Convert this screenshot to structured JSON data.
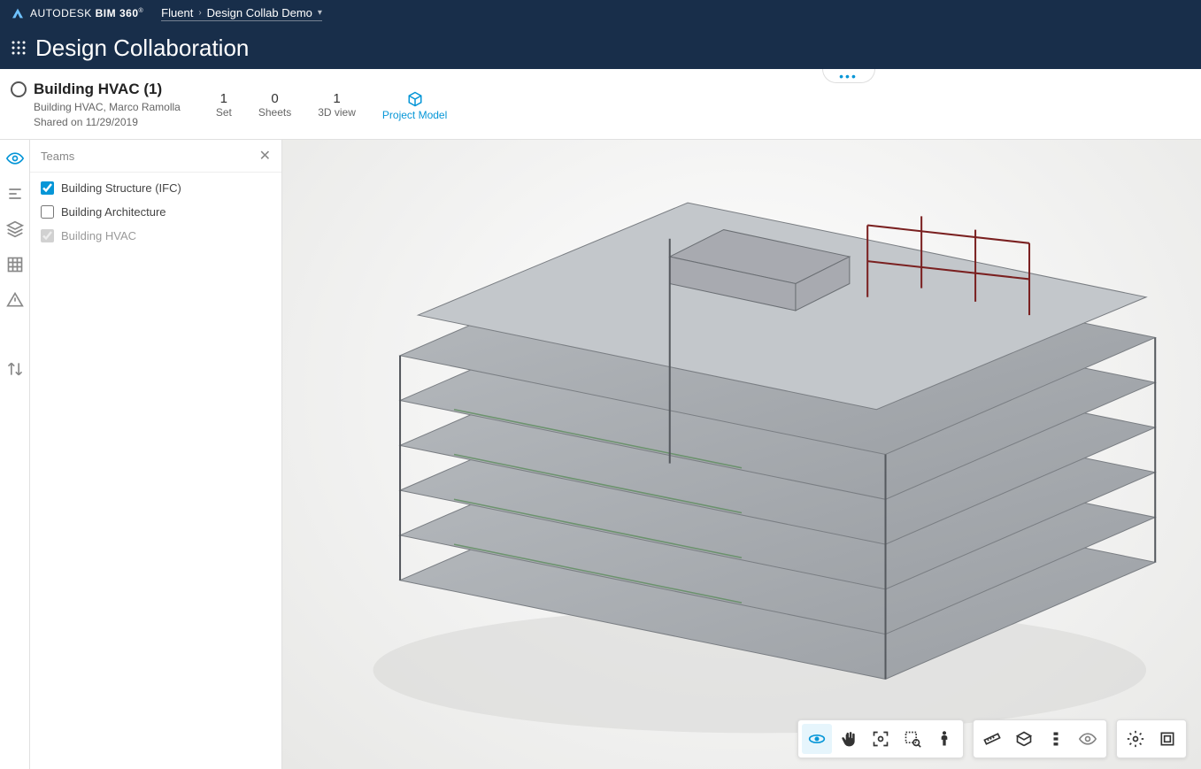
{
  "header": {
    "brand_prefix": "AUTODESK",
    "brand_suffix": "BIM 360",
    "breadcrumb": [
      "Fluent",
      "Design Collab Demo"
    ],
    "module_title": "Design Collaboration"
  },
  "package": {
    "title": "Building HVAC (1)",
    "subtitle": "Building HVAC, Marco Ramolla",
    "shared": "Shared on 11/29/2019",
    "stats": {
      "set": {
        "value": "1",
        "label": "Set"
      },
      "sheets": {
        "value": "0",
        "label": "Sheets"
      },
      "view3d": {
        "value": "1",
        "label": "3D view"
      },
      "project_model": {
        "label": "Project Model"
      }
    }
  },
  "teams_panel": {
    "title": "Teams",
    "items": [
      {
        "label": "Building Structure (IFC)",
        "checked": true,
        "disabled": false
      },
      {
        "label": "Building Architecture",
        "checked": false,
        "disabled": false
      },
      {
        "label": "Building HVAC",
        "checked": true,
        "disabled": true
      }
    ]
  },
  "left_rail": {
    "items": [
      "visibility",
      "levels",
      "layers",
      "grid",
      "issues",
      "changes"
    ]
  },
  "viewer_toolbar": {
    "group_nav": [
      "orbit",
      "pan",
      "fit",
      "zoom-window",
      "walk"
    ],
    "group_tools": [
      "measure",
      "section",
      "explode",
      "ghost"
    ],
    "group_settings": [
      "settings",
      "fullscreen"
    ]
  }
}
